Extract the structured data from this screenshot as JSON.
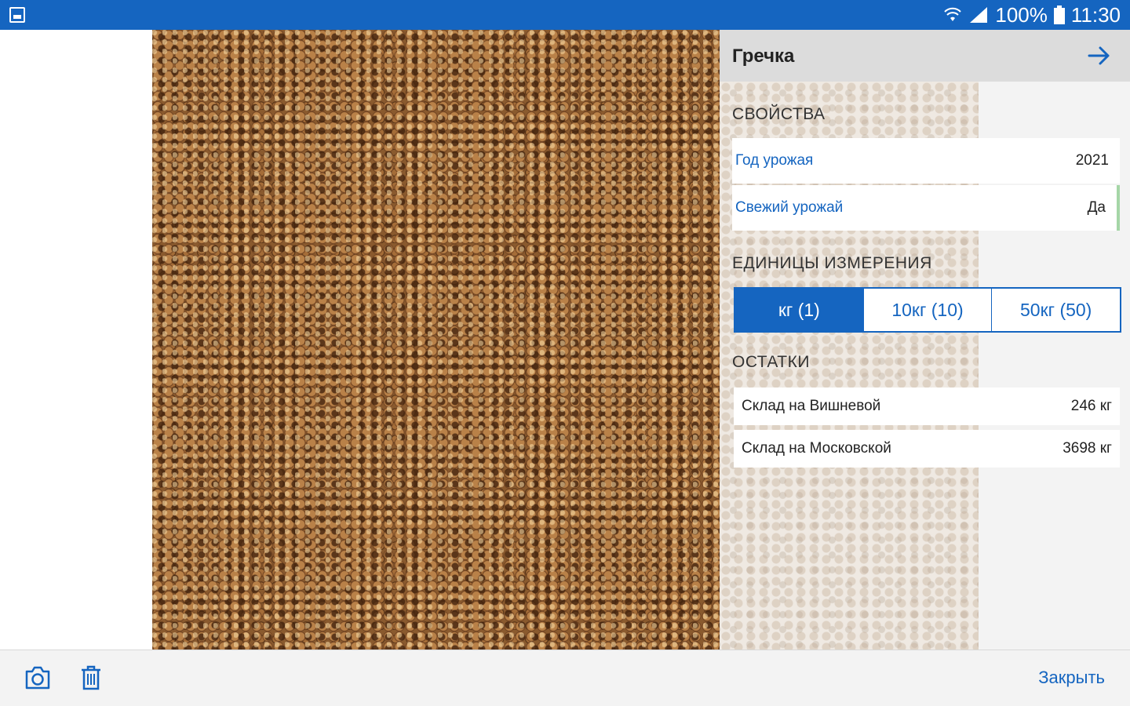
{
  "status_bar": {
    "battery": "100%",
    "time": "11:30",
    "icons": [
      "gallery-icon",
      "wifi-icon",
      "signal-icon",
      "battery-icon"
    ]
  },
  "product": {
    "title": "Гречка"
  },
  "sections": {
    "properties": "СВОЙСТВА",
    "units": "ЕДИНИЦЫ ИЗМЕРЕНИЯ",
    "stock": "ОСТАТКИ"
  },
  "properties": [
    {
      "label": "Год урожая",
      "value": "2021"
    },
    {
      "label": "Свежий урожай",
      "value": "Да"
    }
  ],
  "units": [
    {
      "label": "кг (1)",
      "selected": true
    },
    {
      "label": "10кг (10)",
      "selected": false
    },
    {
      "label": "50кг (50)",
      "selected": false
    }
  ],
  "stock": [
    {
      "warehouse": "Склад на Вишневой",
      "qty": "246 кг"
    },
    {
      "warehouse": "Склад на Московской",
      "qty": "3698 кг"
    }
  ],
  "bottom_bar": {
    "close_label": "Закрыть",
    "icons": [
      "camera-icon",
      "trash-icon"
    ]
  },
  "colors": {
    "accent": "#1565c0",
    "header_bg": "#dcdcdc",
    "panel_bg": "#f3f3f3",
    "fresh_indicator": "#a5d6a7"
  }
}
